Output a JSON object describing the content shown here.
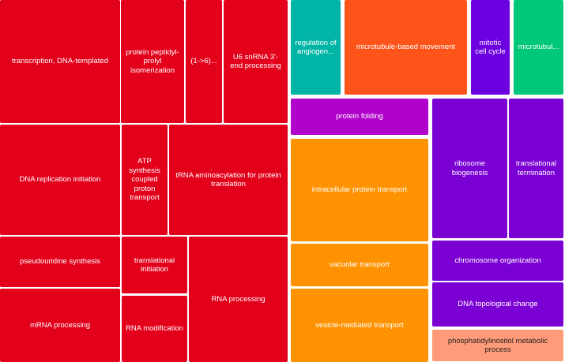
{
  "chart_data": {
    "type": "treemap",
    "title": "",
    "groups": [
      {
        "color": "#e2001a",
        "items": [
          "transcription, DNA-templated",
          "protein peptidyl-prolyl isomerization",
          "(1->6)...",
          "U6 snRNA 3'-end processing",
          "DNA replication initiation",
          "ATP synthesis coupled proton transport",
          "tRNA aminoacylation for protein translation",
          "pseudouridine synthesis",
          "translational initiation",
          "RNA processing",
          "mRNA processing",
          "RNA modification"
        ]
      },
      {
        "color": "#00b5a5",
        "items": [
          "regulation of angiogen..."
        ]
      },
      {
        "color": "#ff5419",
        "items": [
          "microtubule-based movement"
        ]
      },
      {
        "color": "#6b00e0",
        "items": [
          "mitotic cell cycle"
        ]
      },
      {
        "color": "#00c87a",
        "items": [
          "microtubul..."
        ]
      },
      {
        "color": "#b200cc",
        "items": [
          "protein folding"
        ]
      },
      {
        "color": "#ff9200",
        "items": [
          "intracellular protein transport",
          "vacuolar transport",
          "vesicle-mediated transport"
        ]
      },
      {
        "color": "#7b00d4",
        "items": [
          "ribosome biogenesis",
          "translational termination",
          "chromosome organization",
          "DNA topological change"
        ]
      },
      {
        "color": "#ff9b78",
        "items": [
          "phosphatidylinositol metabolic process"
        ]
      }
    ]
  },
  "tiles": [
    {
      "label": "transcription, DNA-templated",
      "color": "#e2001a"
    },
    {
      "label": "protein peptidyl-prolyl isomerization",
      "color": "#e2001a"
    },
    {
      "label": "(1->6)...",
      "color": "#e2001a"
    },
    {
      "label": "U6 snRNA 3'-end processing",
      "color": "#e2001a"
    },
    {
      "label": "DNA replication initiation",
      "color": "#e2001a"
    },
    {
      "label": "ATP synthesis coupled proton transport",
      "color": "#e2001a"
    },
    {
      "label": "tRNA aminoacylation for protein translation",
      "color": "#e2001a"
    },
    {
      "label": "pseudouridine synthesis",
      "color": "#e2001a"
    },
    {
      "label": "translational initiation",
      "color": "#e2001a"
    },
    {
      "label": "RNA processing",
      "color": "#e2001a"
    },
    {
      "label": "mRNA processing",
      "color": "#e2001a"
    },
    {
      "label": "RNA modification",
      "color": "#e2001a"
    },
    {
      "label": "regulation of angiogen...",
      "color": "#00b5a5"
    },
    {
      "label": "microtubule-based movement",
      "color": "#ff5419"
    },
    {
      "label": "mitotic cell cycle",
      "color": "#6b00e0"
    },
    {
      "label": "microtubul...",
      "color": "#00c87a"
    },
    {
      "label": "protein folding",
      "color": "#b200cc"
    },
    {
      "label": "ribosome biogenesis",
      "color": "#7b00d4"
    },
    {
      "label": "translational termination",
      "color": "#7b00d4"
    },
    {
      "label": "intracellular protein transport",
      "color": "#ff9200"
    },
    {
      "label": "vacuolar transport",
      "color": "#ff9200"
    },
    {
      "label": "vesicle-mediated transport",
      "color": "#ff9200"
    },
    {
      "label": "chromosome organization",
      "color": "#7b00d4"
    },
    {
      "label": "DNA topological change",
      "color": "#7b00d4"
    },
    {
      "label": "phosphatidylinositol metabolic process",
      "color": "#ff9b78"
    }
  ]
}
